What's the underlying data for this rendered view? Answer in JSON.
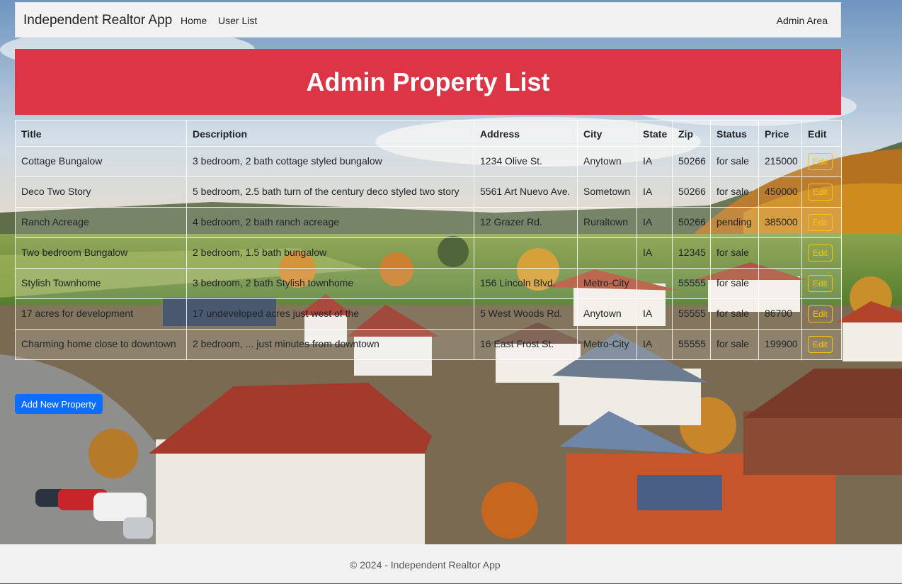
{
  "navbar": {
    "brand": "Independent Realtor App",
    "links": [
      "Home",
      "User List"
    ],
    "admin": "Admin Area"
  },
  "banner": {
    "title": "Admin Property List"
  },
  "table": {
    "headers": [
      "Title",
      "Description",
      "Address",
      "City",
      "State",
      "Zip",
      "Status",
      "Price",
      "Edit"
    ],
    "rows": [
      [
        "Cottage Bungalow",
        "3 bedroom, 2 bath cottage styled bungalow",
        "1234 Olive St.",
        "Anytown",
        "IA",
        "50266",
        "for sale",
        "215000"
      ],
      [
        "Deco Two Story",
        "5 bedroom, 2.5 bath turn of the century deco styled two story",
        "5561 Art Nuevo Ave.",
        "Sometown",
        "IA",
        "50266",
        "for sale",
        "450000"
      ],
      [
        "Ranch Acreage",
        "4 bedroom, 2 bath ranch acreage",
        "12 Grazer Rd.",
        "Ruraltown",
        "IA",
        "50266",
        "pending",
        "385000"
      ],
      [
        "Two bedroom Bungalow",
        "2 bedroom, 1.5 bath bungalow",
        "",
        "",
        "IA",
        "12345",
        "for sale",
        ""
      ],
      [
        "Stylish Townhome",
        "3 bedroom, 2 bath Stylish townhome",
        "156 Lincoln Blvd.",
        "Metro-City",
        "",
        "55555",
        "for sale",
        ""
      ],
      [
        "17 acres for development",
        "17 undeveloped acres just west of the",
        "5 West Woods Rd.",
        "Anytown",
        "IA",
        "55555",
        "for sale",
        "86700"
      ],
      [
        "Charming home close to downtown",
        "2 bedroom, ... just minutes from downtown",
        "16 East Frost St.",
        "Metro-City",
        "IA",
        "55555",
        "for sale",
        "199900"
      ]
    ],
    "edit_label": "Edit"
  },
  "add_button": "Add New Property",
  "footer": "© 2024 - Independent Realtor App",
  "colors": {
    "banner": "#dc3545",
    "primary": "#0d6efd",
    "warning": "#ffc107"
  }
}
